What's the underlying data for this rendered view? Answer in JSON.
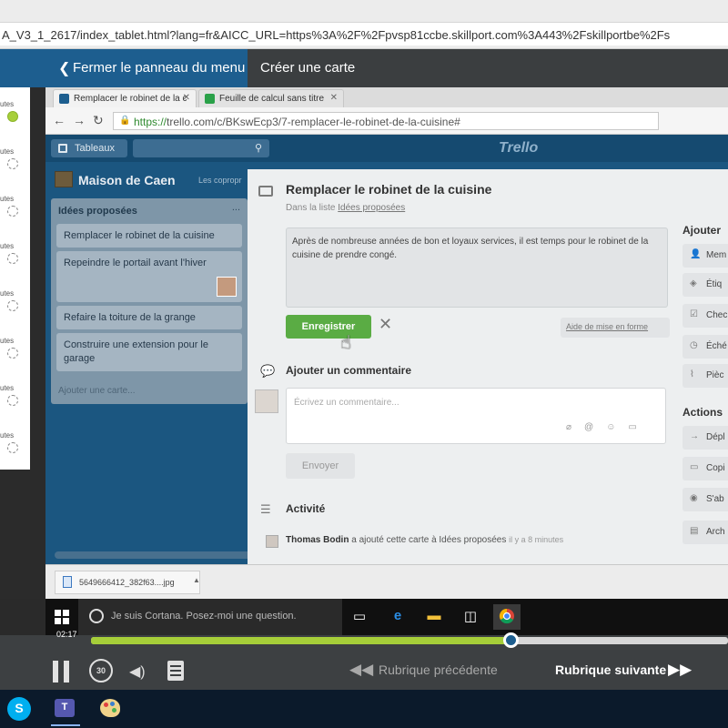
{
  "outer_browser": {
    "url": "A_V3_1_2617/index_tablet.html?lang=fr&AICC_URL=https%3A%2F%2Fpvsp81ccbe.skillport.com%3A443%2Fskillportbe%2Fs"
  },
  "course_header": {
    "menu_button": "Fermer le panneau du menu",
    "create_card": "Créer une carte"
  },
  "sidebar": {
    "items": [
      {
        "label": "utes",
        "done": true
      },
      {
        "label": "utes",
        "done": false
      },
      {
        "label": "utes",
        "done": false
      },
      {
        "label": "utes",
        "done": false
      },
      {
        "label": "utes",
        "done": false
      },
      {
        "label": "utes",
        "done": false
      },
      {
        "label": "utes",
        "done": false
      },
      {
        "label": "utes",
        "done": false
      }
    ]
  },
  "inner_browser": {
    "tabs": [
      {
        "label": "Remplacer le robinet de la c",
        "color": "#1d5e8f"
      },
      {
        "label": "Feuille de calcul sans titre",
        "color": "#2aa149"
      }
    ],
    "url_https": "https://",
    "url_rest": "trello.com/c/BKswEcp3/7-remplacer-le-robinet-de-la-cuisine#"
  },
  "trello": {
    "boards_button": "Tableaux",
    "logo": "Trello",
    "board_title": "Maison de Caen",
    "board_subtitle": "Les copropr",
    "list_title": "Idées proposées",
    "list_menu": "...",
    "cards": [
      "Remplacer le robinet de la cuisine",
      "Repeindre le portail avant l'hiver",
      "Refaire la toiture de la grange",
      "Construire une extension pour le garage"
    ],
    "add_card": "Ajouter une carte..."
  },
  "modal": {
    "title": "Remplacer le robinet de la cuisine",
    "in_list_prefix": "Dans la liste ",
    "in_list_link": "Idées proposées",
    "description": "Après de nombreuse années de bon et loyaux services, il est temps pour le robinet de la cuisine de prendre congé.",
    "save_button": "Enregistrer",
    "format_help": "Aide de mise en forme",
    "comment_heading": "Ajouter un commentaire",
    "comment_placeholder": "Écrivez un commentaire...",
    "send_button": "Envoyer",
    "activity_heading": "Activité",
    "activity_user": "Thomas Bodin",
    "activity_text": " a ajouté cette carte à Idées proposées ",
    "activity_time": "il y a 8 minutes",
    "add_heading": "Ajouter",
    "add_buttons": [
      "Mem",
      "Étiq",
      "Chec",
      "Éché",
      "Pièc"
    ],
    "actions_heading": "Actions",
    "action_buttons": [
      "Dépl",
      "Copi",
      "S'ab",
      "Arch"
    ]
  },
  "download_bar": {
    "filename": "5649666412_382f63....jpg"
  },
  "taskbar": {
    "cortana_text": "Je suis Cortana. Posez-moi une question."
  },
  "player": {
    "time_current": "02:17",
    "progress_fraction": 0.66,
    "rewind_label": "30",
    "prev_section": "Rubrique précédente",
    "next_section": "Rubrique suivante",
    "accent_color": "#a6ce39"
  },
  "outer_taskbar": {
    "skype_label": "S",
    "teams_label": "T"
  }
}
